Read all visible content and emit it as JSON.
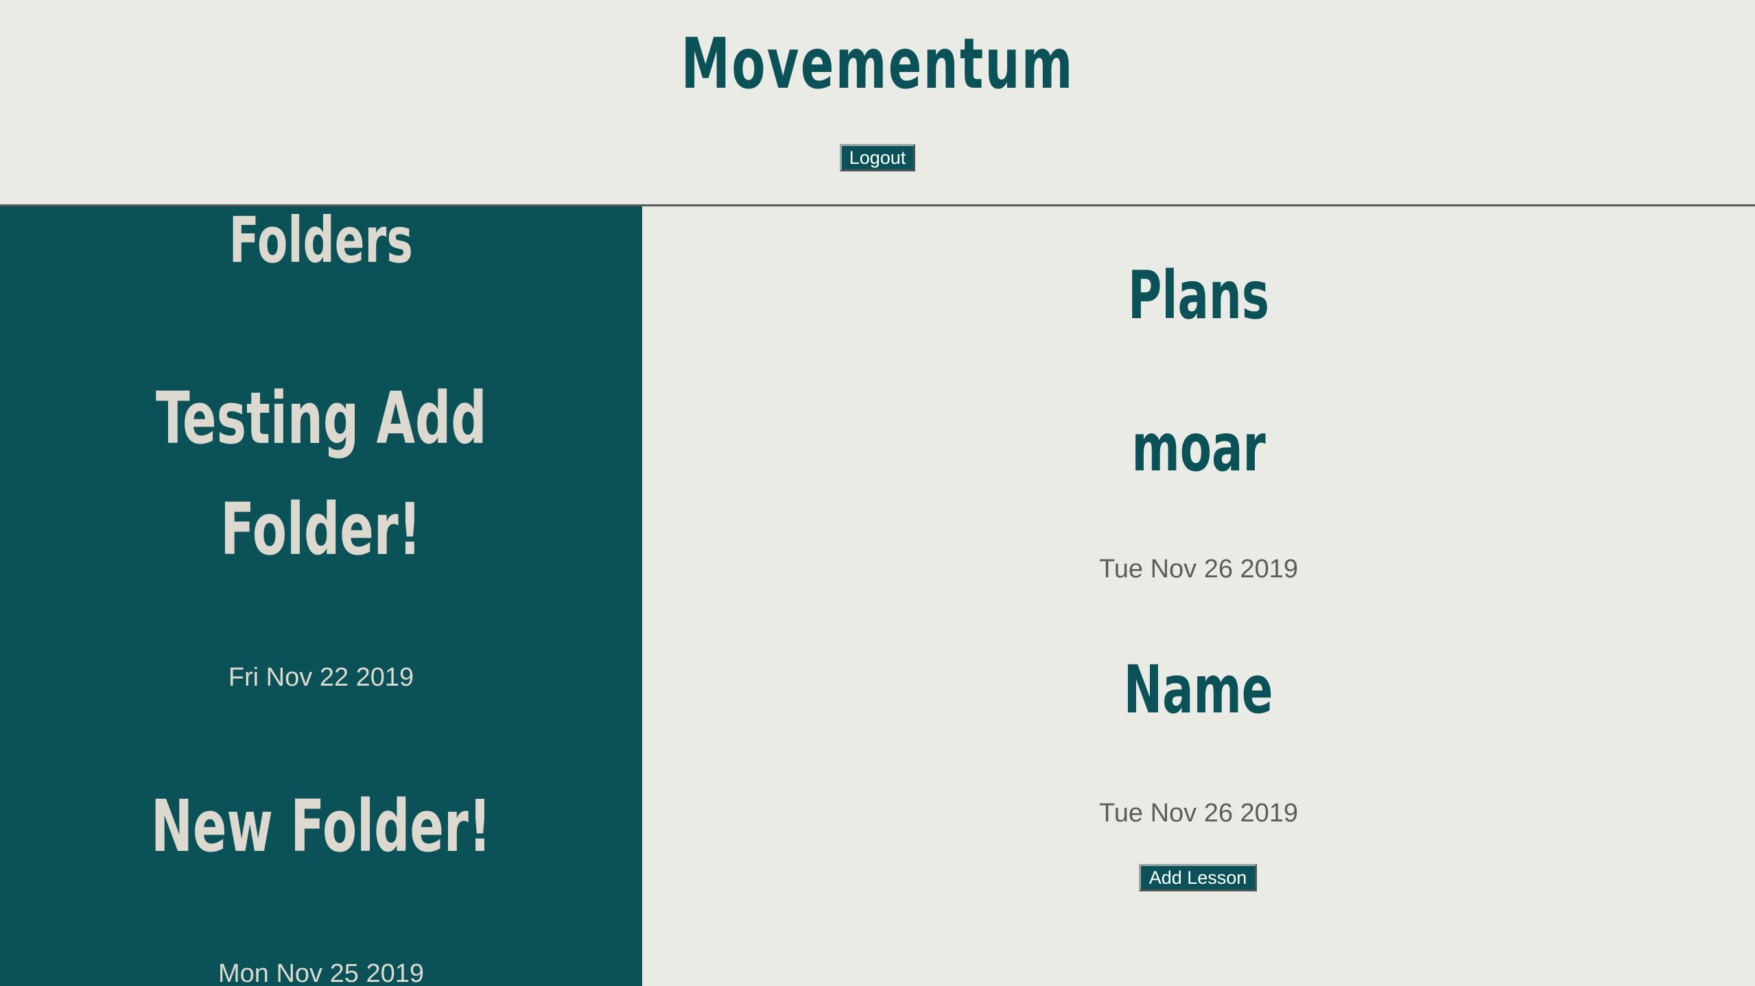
{
  "header": {
    "app_title": "Movementum",
    "logout_label": "Logout"
  },
  "sidebar": {
    "heading": "Folders",
    "folders": [
      {
        "title_line1": "Testing Add",
        "title_line2": "Folder!",
        "date": "Fri Nov 22 2019"
      },
      {
        "title_line1": "New Folder!",
        "date": "Mon Nov 25 2019"
      }
    ]
  },
  "main": {
    "heading": "Plans",
    "plans": [
      {
        "title": "moar",
        "date": "Tue Nov 26 2019"
      },
      {
        "title": "Name",
        "date": "Tue Nov 26 2019"
      }
    ],
    "add_lesson_label": "Add Lesson"
  },
  "colors": {
    "brand_teal": "#0b5158",
    "background": "#ebebe6",
    "sidebar_text": "#ddd9cf",
    "date_text": "#5c5c5c"
  }
}
